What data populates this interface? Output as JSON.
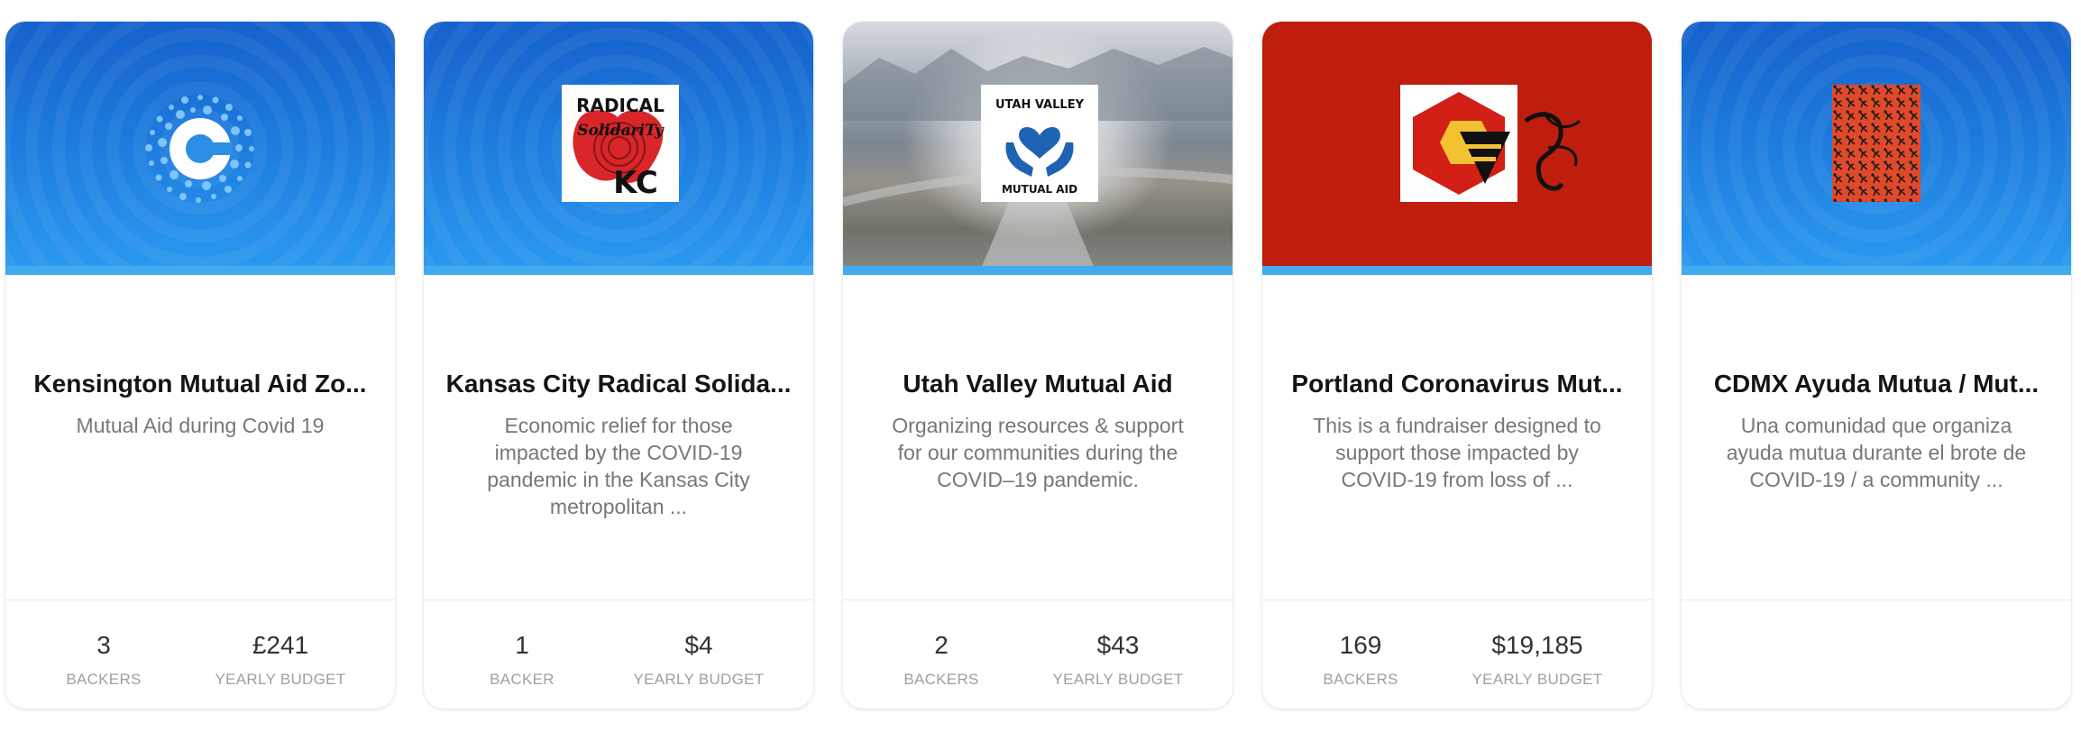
{
  "cards": [
    {
      "name": "Kensington Mutual Aid Zo...",
      "description": "Mutual Aid during Covid 19",
      "stats": [
        {
          "value": "3",
          "label": "BACKERS"
        },
        {
          "value": "£241",
          "label": "YEARLY BUDGET"
        }
      ],
      "logo": "circular-dots-c-logo",
      "banner_color": "#1f80e0"
    },
    {
      "name": "Kansas City Radical Solida...",
      "description": "Economic relief for those impacted by the COVID-19 pandemic in the Kansas City metropolitan ...",
      "stats": [
        {
          "value": "1",
          "label": "BACKER"
        },
        {
          "value": "$4",
          "label": "YEARLY BUDGET"
        }
      ],
      "logo": "radical-solidarity-kc-logo",
      "logo_text": [
        "RADICAL",
        "SolidariTy",
        "KC"
      ],
      "banner_color": "#1f80e0"
    },
    {
      "name": "Utah Valley Mutual Aid",
      "description": "Organizing resources & support for our communities during the COVID–19 pandemic.",
      "stats": [
        {
          "value": "2",
          "label": "BACKERS"
        },
        {
          "value": "$43",
          "label": "YEARLY BUDGET"
        }
      ],
      "logo": "hands-heart-logo",
      "logo_text": [
        "UTAH VALLEY",
        "MUTUAL AID"
      ],
      "banner_color": "#8a9299"
    },
    {
      "name": "Portland Coronavirus Mut...",
      "description": "This is a fundraiser designed to support those impacted by COVID-19 from loss of ...",
      "stats": [
        {
          "value": "169",
          "label": "BACKERS"
        },
        {
          "value": "$19,185",
          "label": "YEARLY BUDGET"
        }
      ],
      "logo": "hexagon-logo",
      "banner_color": "#bf1e0e"
    },
    {
      "name": "CDMX Ayuda Mutua / Mut...",
      "description": "Una comunidad que organiza ayuda mutua durante el brote de COVID-19 / a community ...",
      "stats": [],
      "logo": "red-pattern-logo",
      "banner_color": "#1f80e0"
    }
  ],
  "accent_color": "#41abf0"
}
